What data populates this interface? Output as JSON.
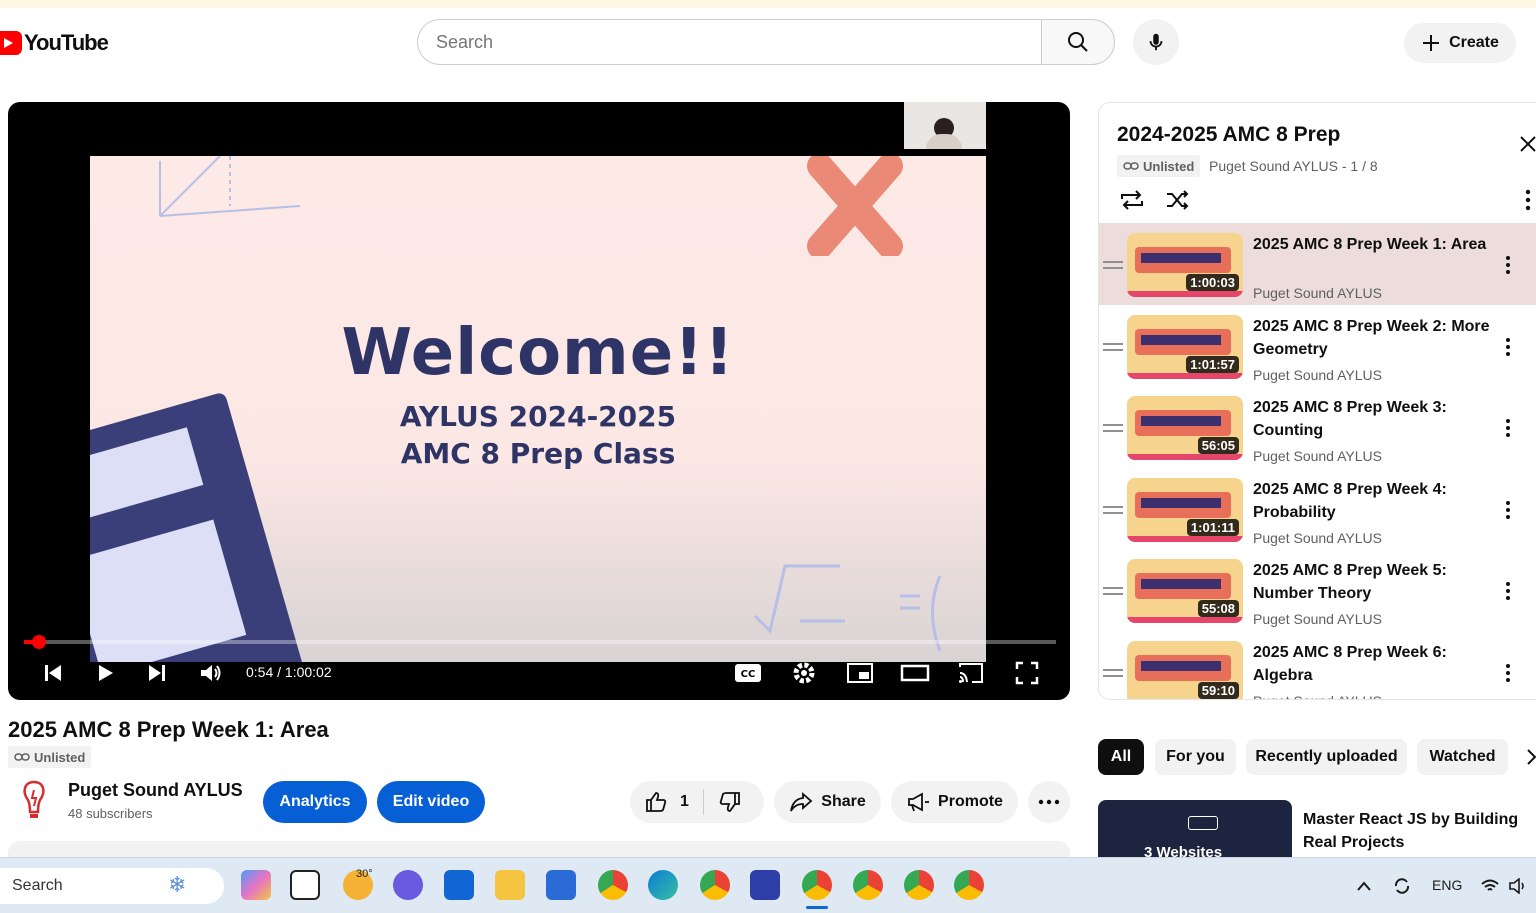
{
  "masthead": {
    "logo_text": "YouTube",
    "search_placeholder": "Search",
    "create_label": "Create"
  },
  "player": {
    "slide_title": "Welcome!!",
    "slide_line1": "AYLUS 2024-2025",
    "slide_line2": "AMC 8 Prep Class",
    "time_current": "0:54",
    "time_total": "1:00:02",
    "timecode": "0:54 / 1:00:02",
    "progress_fraction": 0.015
  },
  "video": {
    "title": "2025 AMC 8 Prep Week 1: Area",
    "visibility": "Unlisted",
    "channel_name": "Puget Sound AYLUS",
    "subscribers": "48 subscribers",
    "analytics_label": "Analytics",
    "edit_label": "Edit video",
    "like_count": "1",
    "share_label": "Share",
    "promote_label": "Promote"
  },
  "playlist": {
    "title": "2024-2025 AMC 8 Prep",
    "visibility": "Unlisted",
    "meta": "Puget Sound AYLUS - 1 / 8",
    "items": [
      {
        "title": "2025 AMC 8 Prep Week 1: Area",
        "channel": "Puget Sound AYLUS",
        "duration": "1:00:03",
        "active": true
      },
      {
        "title": "2025 AMC 8 Prep Week 2: More Geometry",
        "channel": "Puget Sound AYLUS",
        "duration": "1:01:57",
        "active": false
      },
      {
        "title": "2025 AMC 8 Prep Week 3: Counting",
        "channel": "Puget Sound AYLUS",
        "duration": "56:05",
        "active": false
      },
      {
        "title": "2025 AMC 8 Prep Week 4: Probability",
        "channel": "Puget Sound AYLUS",
        "duration": "1:01:11",
        "active": false
      },
      {
        "title": "2025 AMC 8 Prep Week 5: Number Theory",
        "channel": "Puget Sound AYLUS",
        "duration": "55:08",
        "active": false
      },
      {
        "title": "2025 AMC 8 Prep Week 6: Algebra",
        "channel": "Puget Sound AYLUS",
        "duration": "59:10",
        "active": false
      }
    ]
  },
  "chips": [
    "All",
    "For you",
    "Recently uploaded",
    "Watched"
  ],
  "recommendation": {
    "title": "Master React JS by Building Real Projects",
    "thumb_text": "3 Websites"
  },
  "taskbar": {
    "search_label": "Search",
    "weather": "30°",
    "language": "ENG"
  },
  "colors": {
    "brand_red": "#ff0000",
    "action_blue": "#065fd4",
    "slide_ink": "#2e3566"
  }
}
